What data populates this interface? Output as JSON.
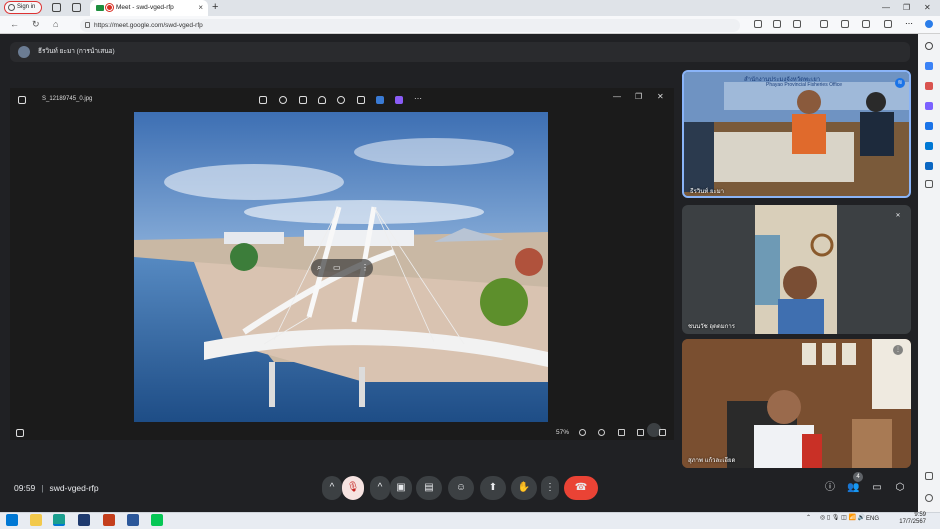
{
  "browser": {
    "signin_label": "Sign in",
    "tab_title": "Meet - swd-vged-rfp",
    "url": "https://meet.google.com/swd-vged-rfp",
    "new_tab_symbol": "+",
    "close_tab_symbol": "×"
  },
  "meet": {
    "presenter_label": "ธีรวินท์ ยะมา (การนำเสนอ)",
    "viewer_filename": "S_12189745_0.jpg",
    "zoom_level": "57%",
    "meeting_time": "09:59",
    "meeting_code": "swd-vged-rfp",
    "participants_count": "4",
    "tiles": [
      {
        "name": "ธีรวินท์ ยะมา",
        "banner": "Phayao Provincial Fisheries Office",
        "banner_th": "สำนักงานประมงจังหวัดพะเยา"
      },
      {
        "name": "ชนนวัช อุดดมการ"
      },
      {
        "name": "สุภาพ แก้วละเอียด"
      }
    ]
  },
  "taskbar": {
    "time": "9:59",
    "date": "17/7/2567",
    "lang": "ENG"
  },
  "colors": {
    "meet_bg": "#202124",
    "end_call": "#ea4335",
    "accent": "#8ab4f8"
  }
}
